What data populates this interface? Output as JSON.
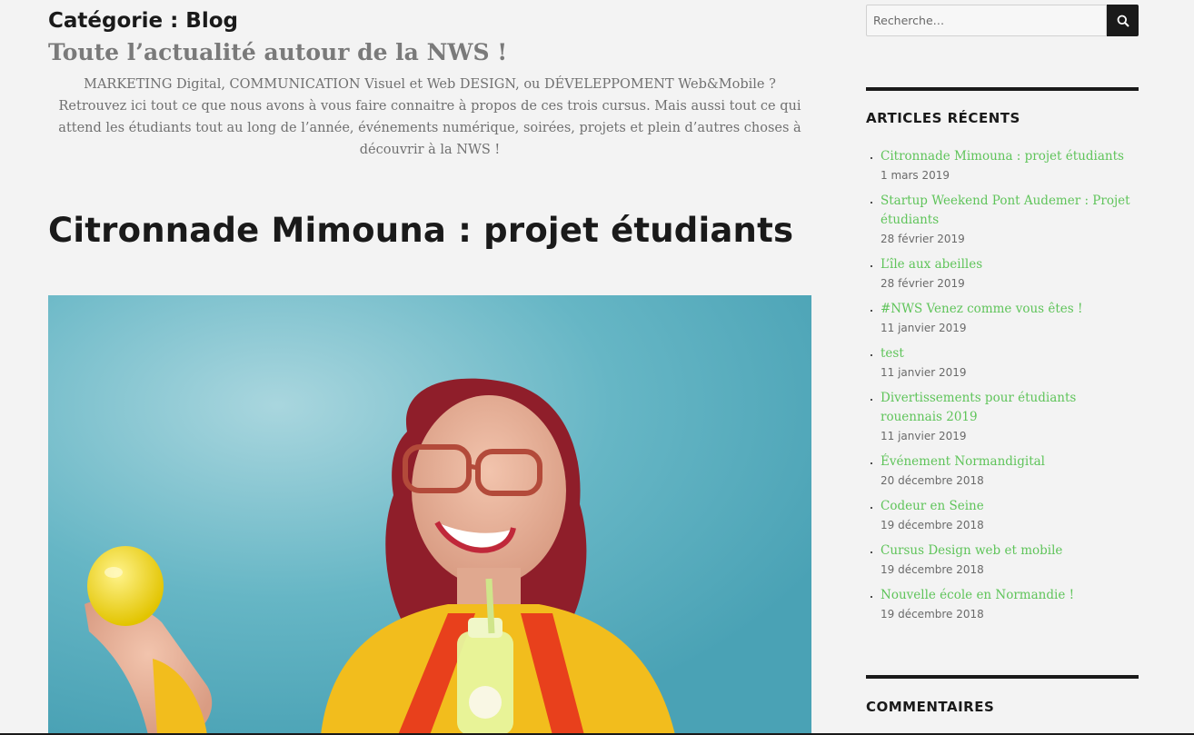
{
  "category": {
    "title": "Catégorie : Blog",
    "subtitle": "Toute l’actualité autour de la NWS !",
    "description_lines": [
      "MARKETING Digital, COMMUNICATION Visuel et Web DESIGN, ou DÉVELEPPOMENT Web&Mobile ?",
      "Retrouvez ici tout ce que nous avons à vous faire connaitre à propos de ces trois cursus. Mais aussi tout ce qui",
      "attend les étudiants tout au long de l’année, événements numérique, soirées, projets et plein d’autres choses à",
      "découvrir à la NWS !"
    ]
  },
  "post": {
    "title": "Citronnade Mimouna : projet étudiants"
  },
  "search": {
    "placeholder": "Recherche…"
  },
  "sidebar": {
    "recent_title": "ARTICLES RÉCENTS",
    "recent_posts": [
      {
        "title": "Citronnade Mimouna : projet étudiants",
        "date": "1 mars 2019"
      },
      {
        "title": "Startup Weekend Pont Audemer : Projet étudiants",
        "date": "28 février 2019"
      },
      {
        "title": "L’île aux abeilles",
        "date": "28 février 2019"
      },
      {
        "title": "#NWS Venez comme vous êtes !",
        "date": "11 janvier 2019"
      },
      {
        "title": "test",
        "date": "11 janvier 2019"
      },
      {
        "title": "Divertissements pour étudiants rouennais 2019",
        "date": "11 janvier 2019"
      },
      {
        "title": "Événement Normandigital",
        "date": "20 décembre 2018"
      },
      {
        "title": "Codeur en Seine",
        "date": "19 décembre 2018"
      },
      {
        "title": "Cursus Design web et mobile",
        "date": "19 décembre 2018"
      },
      {
        "title": "Nouvelle école en Normandie !",
        "date": "19 décembre 2018"
      }
    ],
    "comments_title": "COMMENTAIRES"
  },
  "colors": {
    "link": "#5fc45a",
    "text": "#1a1a1a",
    "muted": "#707070",
    "background": "#f3f3f3"
  },
  "icons": {
    "search_button": "search-icon"
  }
}
